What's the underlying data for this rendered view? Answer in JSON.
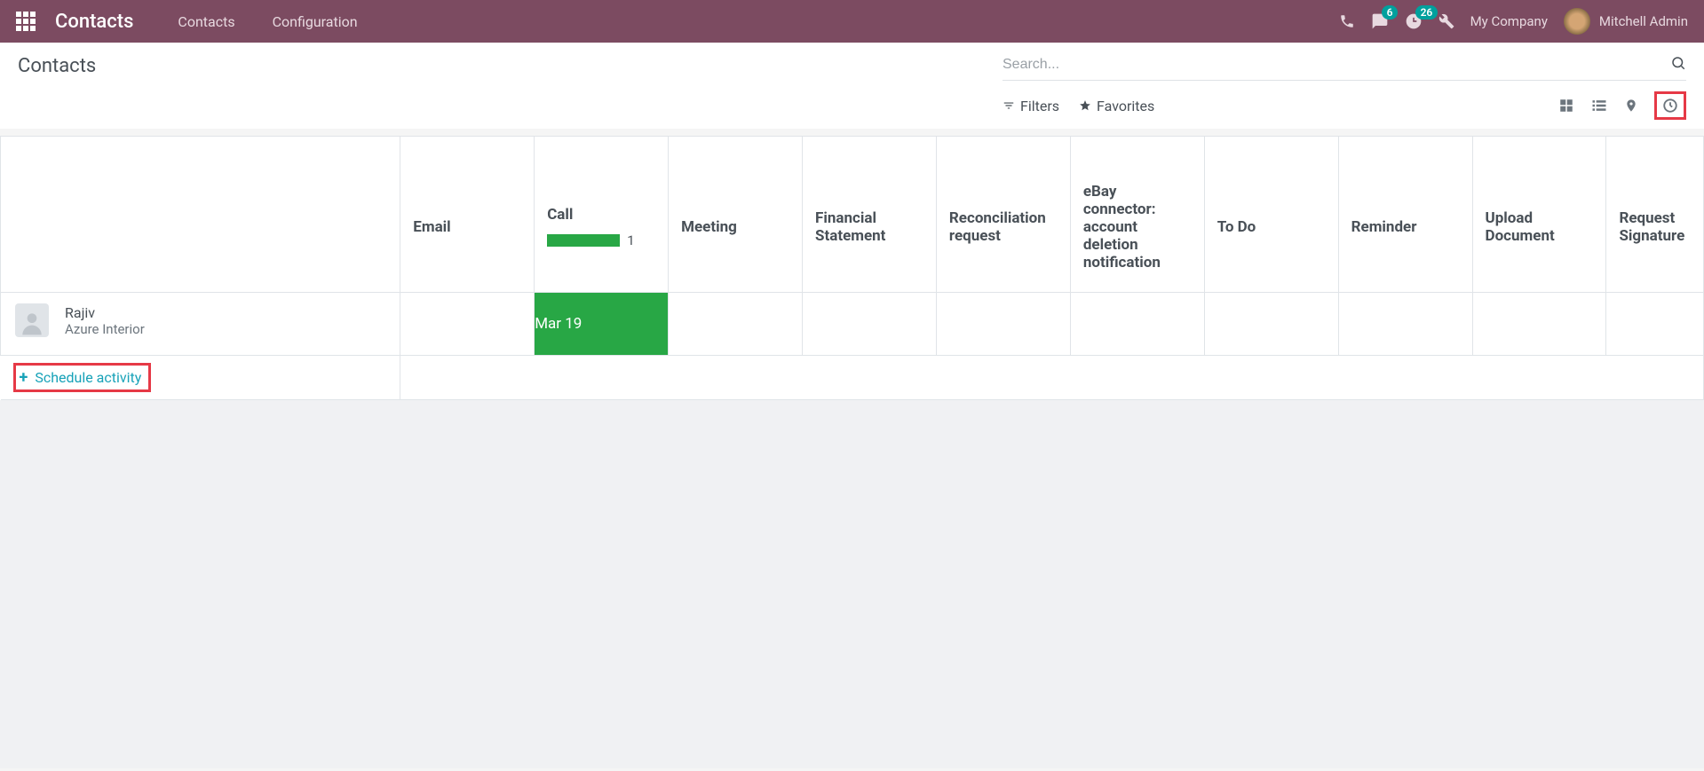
{
  "navbar": {
    "app_title": "Contacts",
    "links": [
      "Contacts",
      "Configuration"
    ],
    "messages_badge": "6",
    "activities_badge": "26",
    "company": "My Company",
    "user": "Mitchell Admin"
  },
  "header": {
    "page_title": "Contacts",
    "search_placeholder": "Search...",
    "filters_label": "Filters",
    "favorites_label": "Favorites"
  },
  "table": {
    "columns": [
      "Email",
      "Call",
      "Meeting",
      "Financial Statement",
      "Reconciliation request",
      "eBay connector: account deletion notification",
      "To Do",
      "Reminder",
      "Upload Document",
      "Request Signature"
    ],
    "call_count": "1",
    "rows": [
      {
        "name": "Rajiv",
        "company": "Azure Interior",
        "call_date": "Mar 19"
      }
    ],
    "schedule_label": "Schedule activity"
  }
}
